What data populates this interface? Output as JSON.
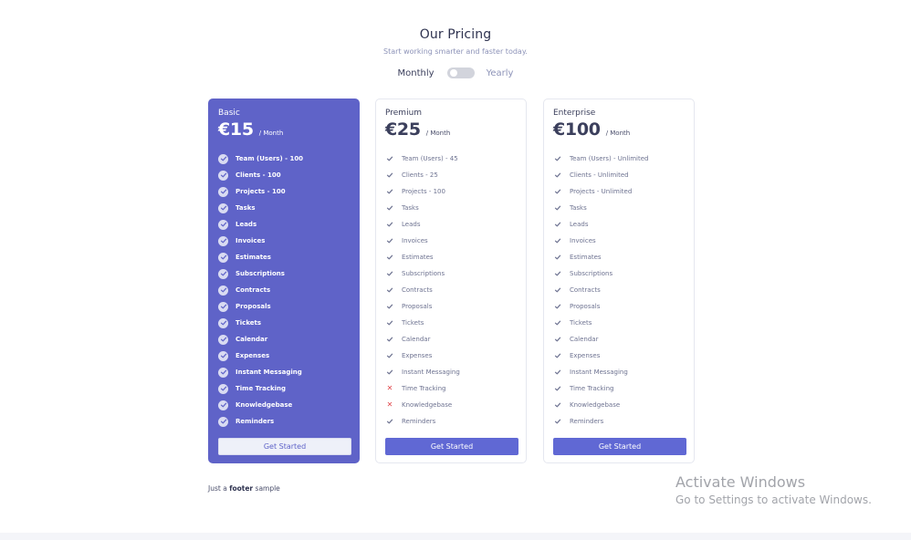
{
  "header": {
    "title": "Our Pricing",
    "subtitle": "Start working smarter and faster today."
  },
  "billing_toggle": {
    "monthly_label": "Monthly",
    "yearly_label": "Yearly",
    "selected": "Monthly"
  },
  "plans": [
    {
      "name": "Basic",
      "price": "€15",
      "period": "/ Month",
      "button": "Get Started",
      "features": [
        {
          "label": "Team (Users) - 100",
          "included": true
        },
        {
          "label": "Clients - 100",
          "included": true
        },
        {
          "label": "Projects - 100",
          "included": true
        },
        {
          "label": "Tasks",
          "included": true
        },
        {
          "label": "Leads",
          "included": true
        },
        {
          "label": "Invoices",
          "included": true
        },
        {
          "label": "Estimates",
          "included": true
        },
        {
          "label": "Subscriptions",
          "included": true
        },
        {
          "label": "Contracts",
          "included": true
        },
        {
          "label": "Proposals",
          "included": true
        },
        {
          "label": "Tickets",
          "included": true
        },
        {
          "label": "Calendar",
          "included": true
        },
        {
          "label": "Expenses",
          "included": true
        },
        {
          "label": "Instant Messaging",
          "included": true
        },
        {
          "label": "Time Tracking",
          "included": true
        },
        {
          "label": "Knowledgebase",
          "included": true
        },
        {
          "label": "Reminders",
          "included": true
        }
      ]
    },
    {
      "name": "Premium",
      "price": "€25",
      "period": "/ Month",
      "button": "Get Started",
      "features": [
        {
          "label": "Team (Users) - 45",
          "included": true
        },
        {
          "label": "Clients - 25",
          "included": true
        },
        {
          "label": "Projects - 100",
          "included": true
        },
        {
          "label": "Tasks",
          "included": true
        },
        {
          "label": "Leads",
          "included": true
        },
        {
          "label": "Invoices",
          "included": true
        },
        {
          "label": "Estimates",
          "included": true
        },
        {
          "label": "Subscriptions",
          "included": true
        },
        {
          "label": "Contracts",
          "included": true
        },
        {
          "label": "Proposals",
          "included": true
        },
        {
          "label": "Tickets",
          "included": true
        },
        {
          "label": "Calendar",
          "included": true
        },
        {
          "label": "Expenses",
          "included": true
        },
        {
          "label": "Instant Messaging",
          "included": true
        },
        {
          "label": "Time Tracking",
          "included": false
        },
        {
          "label": "Knowledgebase",
          "included": false
        },
        {
          "label": "Reminders",
          "included": true
        }
      ]
    },
    {
      "name": "Enterprise",
      "price": "€100",
      "period": "/ Month",
      "button": "Get Started",
      "features": [
        {
          "label": "Team (Users) - Unlimited",
          "included": true
        },
        {
          "label": "Clients - Unlimited",
          "included": true
        },
        {
          "label": "Projects - Unlimited",
          "included": true
        },
        {
          "label": "Tasks",
          "included": true
        },
        {
          "label": "Leads",
          "included": true
        },
        {
          "label": "Invoices",
          "included": true
        },
        {
          "label": "Estimates",
          "included": true
        },
        {
          "label": "Subscriptions",
          "included": true
        },
        {
          "label": "Contracts",
          "included": true
        },
        {
          "label": "Proposals",
          "included": true
        },
        {
          "label": "Tickets",
          "included": true
        },
        {
          "label": "Calendar",
          "included": true
        },
        {
          "label": "Expenses",
          "included": true
        },
        {
          "label": "Instant Messaging",
          "included": true
        },
        {
          "label": "Time Tracking",
          "included": true
        },
        {
          "label": "Knowledgebase",
          "included": true
        },
        {
          "label": "Reminders",
          "included": true
        }
      ]
    }
  ],
  "footer": {
    "prefix": "Just a",
    "bold": "footer",
    "suffix": "sample"
  },
  "watermark": {
    "title": "Activate Windows",
    "subtitle": "Go to Settings to activate Windows."
  },
  "colors": {
    "accent": "#6068d4",
    "featured_card": "#5f63c8",
    "cross": "#e0474c"
  }
}
